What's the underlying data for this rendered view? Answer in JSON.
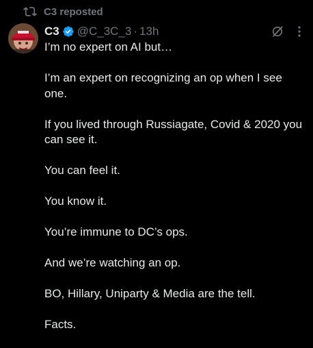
{
  "repost": {
    "icon": "repost-icon",
    "text": "C3 reposted"
  },
  "post": {
    "display_name": "C3",
    "verified_icon": "verified-badge-icon",
    "handle": "@C_3C_3",
    "separator": "·",
    "time": "13h",
    "paragraphs": [
      "I’m no expert on AI but…",
      "I’m an expert on recognizing an op when I see one.",
      "If you lived through Russiagate, Covid & 2020 you can see it.",
      "You can feel it.",
      "You know it.",
      "You’re immune to DC’s ops.",
      "And we’re watching an op.",
      "BO, Hillary, Uniparty & Media are the tell.",
      "Facts."
    ]
  },
  "colors": {
    "background": "#000000",
    "text": "#e7e9ea",
    "muted": "#71767b",
    "verified": "#1d9bf0"
  }
}
